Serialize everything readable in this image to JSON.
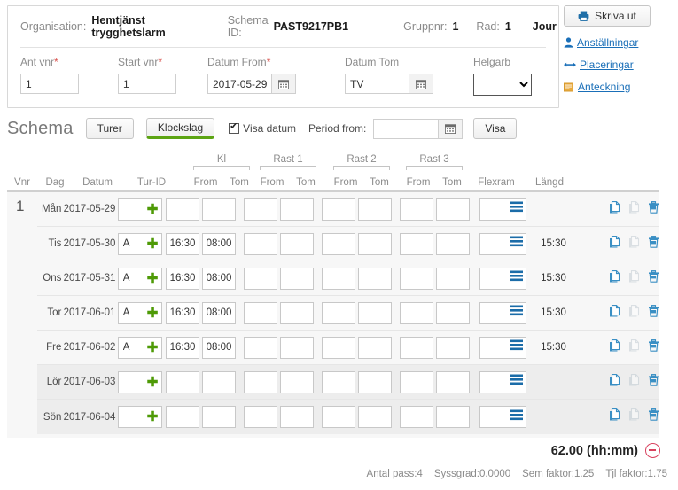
{
  "header": {
    "organisation_label": "Organisation:",
    "organisation_value": "Hemtjänst trygghetslarm",
    "schema_id_label": "Schema ID:",
    "schema_id_value": "PAST9217PB1",
    "gruppnr_label": "Gruppnr:",
    "gruppnr_value": "1",
    "rad_label": "Rad:",
    "rad_value": "1",
    "jour_label": "Jour"
  },
  "form": {
    "ant_vnr": {
      "label": "Ant vnr",
      "required": "*",
      "value": "1"
    },
    "start_vnr": {
      "label": "Start vnr",
      "required": "*",
      "value": "1"
    },
    "datum_from": {
      "label": "Datum From",
      "required": "*",
      "value": "2017-05-29",
      "calendar_icon": "calendar-icon"
    },
    "datum_tom": {
      "label": "Datum Tom",
      "value": "TV",
      "calendar_icon": "calendar-icon"
    },
    "helgarb": {
      "label": "Helgarb",
      "value": ""
    }
  },
  "actions": {
    "print": {
      "label": "Skriva ut",
      "icon": "printer-icon"
    },
    "links": [
      {
        "label": "Anställningar",
        "icon": "person-icon"
      },
      {
        "label": "Placeringar",
        "icon": "arrows-icon"
      },
      {
        "label": "Anteckning",
        "icon": "note-icon"
      }
    ]
  },
  "schema": {
    "title": "Schema",
    "tab_turer": "Turer",
    "tab_klockslag": "Klockslag",
    "visa_datum": "Visa datum",
    "period_from_label": "Period from:",
    "period_from_value": "",
    "visa_button": "Visa"
  },
  "grid": {
    "groups": [
      {
        "name": "Kl"
      },
      {
        "name": "Rast 1"
      },
      {
        "name": "Rast 2"
      },
      {
        "name": "Rast 3"
      }
    ],
    "columns": {
      "vnr": "Vnr",
      "dag": "Dag",
      "datum": "Datum",
      "tur_id": "Tur-ID",
      "from": "From",
      "tom": "Tom",
      "flexram": "Flexram",
      "langd": "Längd"
    },
    "vnr_value": "1",
    "rows": [
      {
        "dag": "Mån",
        "datum": "2017-05-29",
        "tur": "",
        "kl_from": "",
        "kl_tom": "",
        "r1_from": "",
        "r1_tom": "",
        "r2_from": "",
        "r2_tom": "",
        "r3_from": "",
        "r3_tom": "",
        "flexram": "",
        "langd": "",
        "weekend": false
      },
      {
        "dag": "Tis",
        "datum": "2017-05-30",
        "tur": "A",
        "kl_from": "16:30",
        "kl_tom": "08:00",
        "r1_from": "",
        "r1_tom": "",
        "r2_from": "",
        "r2_tom": "",
        "r3_from": "",
        "r3_tom": "",
        "flexram": "",
        "langd": "15:30",
        "weekend": false
      },
      {
        "dag": "Ons",
        "datum": "2017-05-31",
        "tur": "A",
        "kl_from": "16:30",
        "kl_tom": "08:00",
        "r1_from": "",
        "r1_tom": "",
        "r2_from": "",
        "r2_tom": "",
        "r3_from": "",
        "r3_tom": "",
        "flexram": "",
        "langd": "15:30",
        "weekend": false
      },
      {
        "dag": "Tor",
        "datum": "2017-06-01",
        "tur": "A",
        "kl_from": "16:30",
        "kl_tom": "08:00",
        "r1_from": "",
        "r1_tom": "",
        "r2_from": "",
        "r2_tom": "",
        "r3_from": "",
        "r3_tom": "",
        "flexram": "",
        "langd": "15:30",
        "weekend": false
      },
      {
        "dag": "Fre",
        "datum": "2017-06-02",
        "tur": "A",
        "kl_from": "16:30",
        "kl_tom": "08:00",
        "r1_from": "",
        "r1_tom": "",
        "r2_from": "",
        "r2_tom": "",
        "r3_from": "",
        "r3_tom": "",
        "flexram": "",
        "langd": "15:30",
        "weekend": false
      },
      {
        "dag": "Lör",
        "datum": "2017-06-03",
        "tur": "",
        "kl_from": "",
        "kl_tom": "",
        "r1_from": "",
        "r1_tom": "",
        "r2_from": "",
        "r2_tom": "",
        "r3_from": "",
        "r3_tom": "",
        "flexram": "",
        "langd": "",
        "weekend": true
      },
      {
        "dag": "Sön",
        "datum": "2017-06-04",
        "tur": "",
        "kl_from": "",
        "kl_tom": "",
        "r1_from": "",
        "r1_tom": "",
        "r2_from": "",
        "r2_tom": "",
        "r3_from": "",
        "r3_tom": "",
        "flexram": "",
        "langd": "",
        "weekend": true
      }
    ],
    "row_icons": {
      "copy": "copy-icon",
      "paste": "paste-icon",
      "delete": "trash-icon"
    }
  },
  "footer": {
    "total": "62.00 (hh:mm)",
    "collapse_icon": "minus-circle-icon",
    "stats": [
      "Antal pass:4",
      "Syssgrad:0.0000",
      "Sem faktor:1.25",
      "Tjl faktor:1.75"
    ]
  },
  "colors": {
    "link": "#1a6fb8",
    "plus_green": "#4e9a06",
    "active_tab_underline": "#5ca413",
    "minus_red": "#d9425f",
    "icon_blue": "#3a8fc4",
    "required_red": "#d9534f"
  }
}
